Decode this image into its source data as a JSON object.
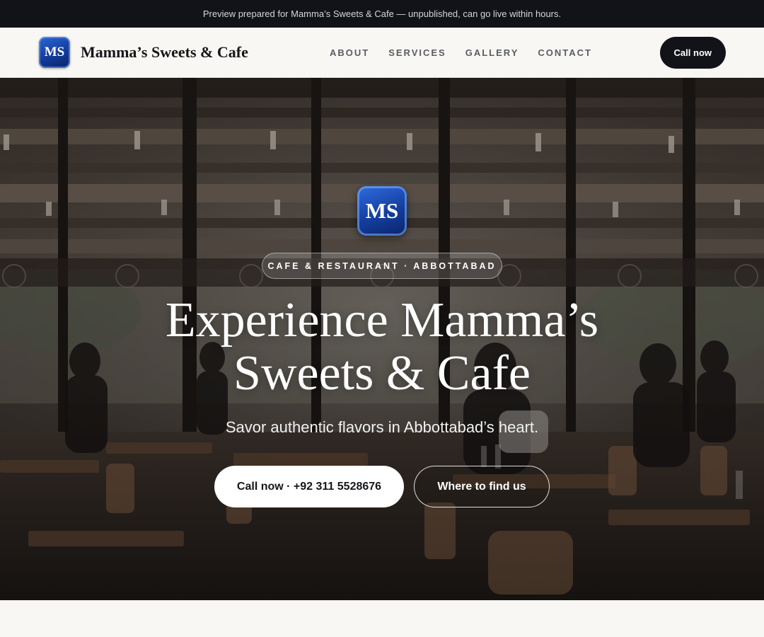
{
  "preview_banner": {
    "text": "Preview prepared for Mamma’s Sweets & Cafe — unpublished, can go live within hours."
  },
  "header": {
    "logo_text": "MS",
    "brand_name": "Mamma’s Sweets & Cafe",
    "nav": [
      "ABOUT",
      "SERVICES",
      "GALLERY",
      "CONTACT"
    ],
    "call_label": "Call now"
  },
  "hero": {
    "logo_text": "MS",
    "badge": "CAFE & RESTAURANT · ABBOTTABAD",
    "title_line1": "Experience Mamma’s",
    "title_line2": "Sweets & Cafe",
    "subtitle": "Savor authentic flavors in Abbottabad’s heart.",
    "primary_button": "Call now · +92 311 5528676",
    "secondary_button": "Where to find us",
    "background_image": "cafe-interior-photo"
  },
  "colors": {
    "banner_bg": "#111318",
    "header_bg": "#f8f7f3",
    "logo_blue": "#143e9e",
    "accent_dark": "#111318",
    "hero_text": "#ffffff"
  }
}
